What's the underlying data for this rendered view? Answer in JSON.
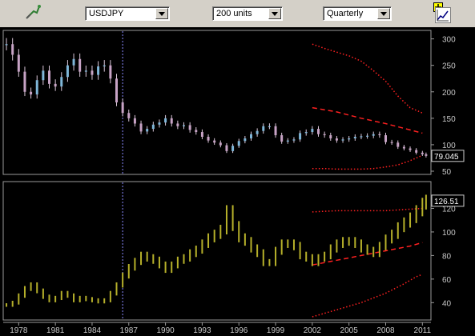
{
  "toolbar": {
    "tool_icon": "drawing-tool-icon",
    "symbol": "USDJPY",
    "units": "200 units",
    "period": "Quarterly",
    "zoom_icon": "zoom-icon",
    "chart_icon": "line-chart-icon"
  },
  "colors": {
    "panel_bg": "#000000",
    "upper_candles": "#c7a3c5",
    "lower_bars": "#b6b02a",
    "bands": "#ff2020",
    "grid_label": "#c8c8c8"
  },
  "chart_data": [
    {
      "type": "candlestick",
      "title": "",
      "ylabel": "",
      "ylim": [
        50,
        310
      ],
      "y_ticks": [
        "300",
        "250",
        "200",
        "150",
        "100",
        "50"
      ],
      "last_value_label": "79.045",
      "x_ticks": [
        "1978",
        "1981",
        "1984",
        "1987",
        "1990",
        "1993",
        "1996",
        "1999",
        "2002",
        "2005",
        "2008",
        "2011"
      ],
      "x_range": [
        1976.8,
        2011.7
      ],
      "cursor_x": 1986.5,
      "series": [
        {
          "points": [
            [
              1977.0,
              290
            ],
            [
              1977.5,
              270
            ],
            [
              1978.0,
              238
            ],
            [
              1978.5,
              200
            ],
            [
              1979.0,
              195
            ],
            [
              1979.5,
              222
            ],
            [
              1980.0,
              240
            ],
            [
              1980.5,
              215
            ],
            [
              1981.0,
              210
            ],
            [
              1981.5,
              228
            ],
            [
              1982.0,
              250
            ],
            [
              1982.5,
              262
            ],
            [
              1983.0,
              238
            ],
            [
              1983.5,
              240
            ],
            [
              1984.0,
              232
            ],
            [
              1984.5,
              248
            ],
            [
              1985.0,
              250
            ],
            [
              1985.5,
              225
            ],
            [
              1986.0,
              180
            ],
            [
              1986.5,
              160
            ],
            [
              1987.0,
              150
            ],
            [
              1987.5,
              140
            ],
            [
              1988.0,
              125
            ],
            [
              1988.5,
              130
            ],
            [
              1989.0,
              138
            ],
            [
              1989.5,
              142
            ],
            [
              1990.0,
              150
            ],
            [
              1990.5,
              140
            ],
            [
              1991.0,
              135
            ],
            [
              1991.5,
              137
            ],
            [
              1992.0,
              128
            ],
            [
              1992.5,
              124
            ],
            [
              1993.0,
              115
            ],
            [
              1993.5,
              108
            ],
            [
              1994.0,
              104
            ],
            [
              1994.5,
              99
            ],
            [
              1995.0,
              88
            ],
            [
              1995.5,
              98
            ],
            [
              1996.0,
              107
            ],
            [
              1996.5,
              112
            ],
            [
              1997.0,
              120
            ],
            [
              1997.5,
              126
            ],
            [
              1998.0,
              135
            ],
            [
              1998.5,
              135
            ],
            [
              1999.0,
              118
            ],
            [
              1999.5,
              106
            ],
            [
              2000.0,
              108
            ],
            [
              2000.5,
              110
            ],
            [
              2001.0,
              122
            ],
            [
              2001.5,
              124
            ],
            [
              2002.0,
              130
            ],
            [
              2002.5,
              120
            ],
            [
              2003.0,
              118
            ],
            [
              2003.5,
              112
            ],
            [
              2004.0,
              108
            ],
            [
              2004.5,
              110
            ],
            [
              2005.0,
              112
            ],
            [
              2005.5,
              115
            ],
            [
              2006.0,
              116
            ],
            [
              2006.5,
              117
            ],
            [
              2007.0,
              120
            ],
            [
              2007.5,
              118
            ],
            [
              2008.0,
              105
            ],
            [
              2008.5,
              104
            ],
            [
              2009.0,
              96
            ],
            [
              2009.5,
              93
            ],
            [
              2010.0,
              90
            ],
            [
              2010.5,
              85
            ],
            [
              2011.0,
              82
            ],
            [
              2011.3,
              79
            ]
          ]
        }
      ],
      "bands": {
        "upper": [
          [
            2002.0,
            290
          ],
          [
            2003.0,
            282
          ],
          [
            2004.0,
            275
          ],
          [
            2005.0,
            268
          ],
          [
            2006.0,
            258
          ],
          [
            2007.0,
            240
          ],
          [
            2008.0,
            220
          ],
          [
            2009.0,
            192
          ],
          [
            2010.0,
            170
          ],
          [
            2011.0,
            160
          ]
        ],
        "middle": [
          [
            2002.0,
            170
          ],
          [
            2004.0,
            162
          ],
          [
            2006.0,
            150
          ],
          [
            2008.0,
            140
          ],
          [
            2010.0,
            128
          ],
          [
            2011.0,
            122
          ]
        ],
        "lower": [
          [
            2002.0,
            55
          ],
          [
            2003.0,
            55
          ],
          [
            2004.0,
            54
          ],
          [
            2005.0,
            54
          ],
          [
            2006.0,
            54
          ],
          [
            2007.0,
            55
          ],
          [
            2008.0,
            58
          ],
          [
            2009.0,
            62
          ],
          [
            2010.0,
            70
          ],
          [
            2011.0,
            80
          ]
        ]
      }
    },
    {
      "type": "ohlc",
      "title": "",
      "ylabel": "",
      "ylim": [
        28,
        140
      ],
      "y_ticks": [
        "120",
        "100",
        "80",
        "60",
        "40"
      ],
      "last_value_label": "126.51",
      "x_ticks": [
        "1978",
        "1981",
        "1984",
        "1987",
        "1990",
        "1993",
        "1996",
        "1999",
        "2002",
        "2005",
        "2008",
        "2011"
      ],
      "x_range": [
        1976.8,
        2011.7
      ],
      "cursor_x": 1986.5,
      "series": [
        {
          "points": [
            [
              1977.0,
              38
            ],
            [
              1977.5,
              40
            ],
            [
              1978.0,
              46
            ],
            [
              1978.5,
              52
            ],
            [
              1979.0,
              55
            ],
            [
              1979.5,
              50
            ],
            [
              1980.0,
              45
            ],
            [
              1980.5,
              42
            ],
            [
              1981.0,
              44
            ],
            [
              1981.5,
              48
            ],
            [
              1982.0,
              46
            ],
            [
              1982.5,
              42
            ],
            [
              1983.0,
              44
            ],
            [
              1983.5,
              43
            ],
            [
              1984.0,
              42
            ],
            [
              1984.5,
              41
            ],
            [
              1985.0,
              42
            ],
            [
              1985.5,
              48
            ],
            [
              1986.0,
              55
            ],
            [
              1986.5,
              63
            ],
            [
              1987.0,
              70
            ],
            [
              1987.5,
              75
            ],
            [
              1988.0,
              80
            ],
            [
              1988.5,
              78
            ],
            [
              1989.0,
              76
            ],
            [
              1989.5,
              72
            ],
            [
              1990.0,
              68
            ],
            [
              1990.5,
              72
            ],
            [
              1991.0,
              76
            ],
            [
              1991.5,
              78
            ],
            [
              1992.0,
              82
            ],
            [
              1992.5,
              85
            ],
            [
              1993.0,
              90
            ],
            [
              1993.5,
              95
            ],
            [
              1994.0,
              98
            ],
            [
              1994.5,
              102
            ],
            [
              1995.0,
              118
            ],
            [
              1995.5,
              105
            ],
            [
              1996.0,
              95
            ],
            [
              1996.5,
              92
            ],
            [
              1997.0,
              86
            ],
            [
              1997.5,
              82
            ],
            [
              1998.0,
              74
            ],
            [
              1998.5,
              74
            ],
            [
              1999.0,
              84
            ],
            [
              1999.5,
              90
            ],
            [
              2000.0,
              90
            ],
            [
              2000.5,
              88
            ],
            [
              2001.0,
              80
            ],
            [
              2001.5,
              78
            ],
            [
              2002.0,
              74
            ],
            [
              2002.5,
              78
            ],
            [
              2003.0,
              80
            ],
            [
              2003.5,
              86
            ],
            [
              2004.0,
              90
            ],
            [
              2004.5,
              92
            ],
            [
              2005.0,
              92
            ],
            [
              2005.5,
              90
            ],
            [
              2006.0,
              86
            ],
            [
              2006.5,
              84
            ],
            [
              2007.0,
              82
            ],
            [
              2007.5,
              88
            ],
            [
              2008.0,
              94
            ],
            [
              2008.5,
              98
            ],
            [
              2009.0,
              104
            ],
            [
              2009.5,
              108
            ],
            [
              2010.0,
              112
            ],
            [
              2010.5,
              118
            ],
            [
              2011.0,
              124
            ],
            [
              2011.3,
              126.5
            ]
          ]
        }
      ],
      "bands": {
        "upper": [
          [
            2002.0,
            117
          ],
          [
            2004.0,
            118
          ],
          [
            2006.0,
            118
          ],
          [
            2008.0,
            118
          ],
          [
            2009.5,
            119
          ],
          [
            2011.0,
            120
          ]
        ],
        "middle": [
          [
            2002.0,
            72
          ],
          [
            2004.0,
            76
          ],
          [
            2006.0,
            80
          ],
          [
            2008.0,
            84
          ],
          [
            2010.0,
            88
          ],
          [
            2011.0,
            91
          ]
        ],
        "lower": [
          [
            2002.0,
            28
          ],
          [
            2004.0,
            34
          ],
          [
            2006.0,
            40
          ],
          [
            2008.0,
            48
          ],
          [
            2009.5,
            56
          ],
          [
            2010.5,
            62
          ],
          [
            2011.0,
            64
          ]
        ]
      }
    }
  ]
}
